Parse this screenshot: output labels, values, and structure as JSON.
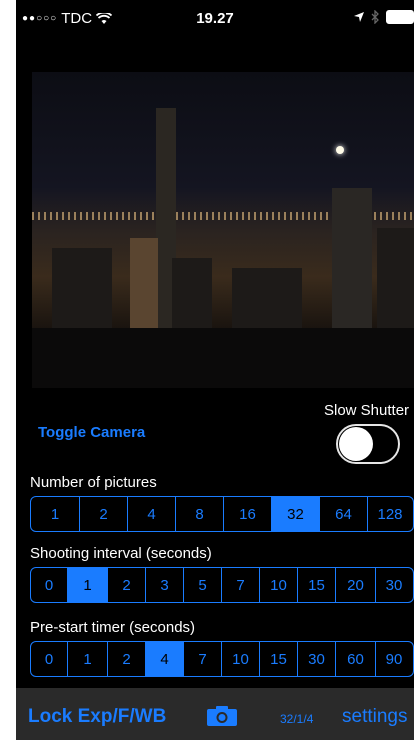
{
  "status_bar": {
    "carrier": "TDC",
    "signal_dots": "●●○○○",
    "time": "19.27"
  },
  "camera": {
    "toggle_label": "Toggle Camera",
    "slow_shutter_label": "Slow Shutter",
    "slow_shutter_on": false
  },
  "number_of_pictures": {
    "label": "Number of pictures",
    "options": [
      "1",
      "2",
      "4",
      "8",
      "16",
      "32",
      "64",
      "128"
    ],
    "selected": "32"
  },
  "shooting_interval": {
    "label": "Shooting interval (seconds)",
    "options": [
      "0",
      "1",
      "2",
      "3",
      "5",
      "7",
      "10",
      "15",
      "20",
      "30"
    ],
    "selected": "1"
  },
  "prestart_timer": {
    "label": "Pre-start timer (seconds)",
    "options": [
      "0",
      "1",
      "2",
      "4",
      "7",
      "10",
      "15",
      "30",
      "60",
      "90"
    ],
    "selected": "4"
  },
  "toolbar": {
    "lock_label": "Lock Exp/F/WB",
    "counter": "32/1/4",
    "settings_label": "settings"
  },
  "colors": {
    "accent": "#1a7cff",
    "background": "#000000",
    "toolbar": "#2a2a2a"
  },
  "icons": [
    "wifi-icon",
    "location-arrow-icon",
    "bluetooth-icon",
    "battery-icon",
    "camera-icon"
  ]
}
